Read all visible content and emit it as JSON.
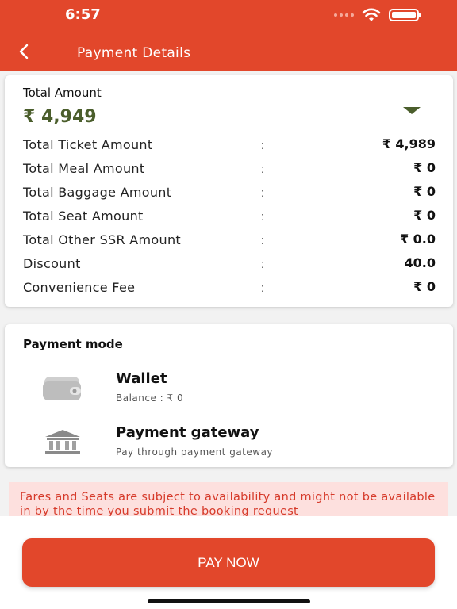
{
  "status_bar": {
    "time": "6:57"
  },
  "nav": {
    "title": "Payment Details"
  },
  "amount": {
    "total_label": "Total Amount",
    "total_value": "₹ 4,949",
    "rows": [
      {
        "label": "Total Ticket Amount",
        "colon": ":",
        "value": "₹ 4,989"
      },
      {
        "label": "Total Meal Amount",
        "colon": ":",
        "value": "₹ 0"
      },
      {
        "label": "Total Baggage Amount",
        "colon": ":",
        "value": "₹ 0"
      },
      {
        "label": "Total Seat Amount",
        "colon": ":",
        "value": "₹ 0"
      },
      {
        "label": "Total Other SSR Amount",
        "colon": ":",
        "value": "₹ 0.0"
      },
      {
        "label": "Discount",
        "colon": ":",
        "value": "40.0"
      },
      {
        "label": "Convenience Fee",
        "colon": ":",
        "value": "₹ 0"
      }
    ]
  },
  "payment": {
    "title": "Payment mode",
    "wallet": {
      "name": "Wallet",
      "sub": "Balance :  ₹ 0",
      "icon": "wallet-icon"
    },
    "gateway": {
      "name": "Payment gateway",
      "sub": "Pay through payment gateway",
      "icon": "bank-icon"
    }
  },
  "notice": {
    "text": "Fares and Seats are subject to availability and might not be available in by the time you submit the booking request"
  },
  "pay_button": {
    "label": "PAY NOW"
  },
  "colors": {
    "accent": "#e2472b",
    "total_green": "#4b5e2c",
    "notice_bg": "#fde0de",
    "notice_text": "#d63a2a"
  }
}
